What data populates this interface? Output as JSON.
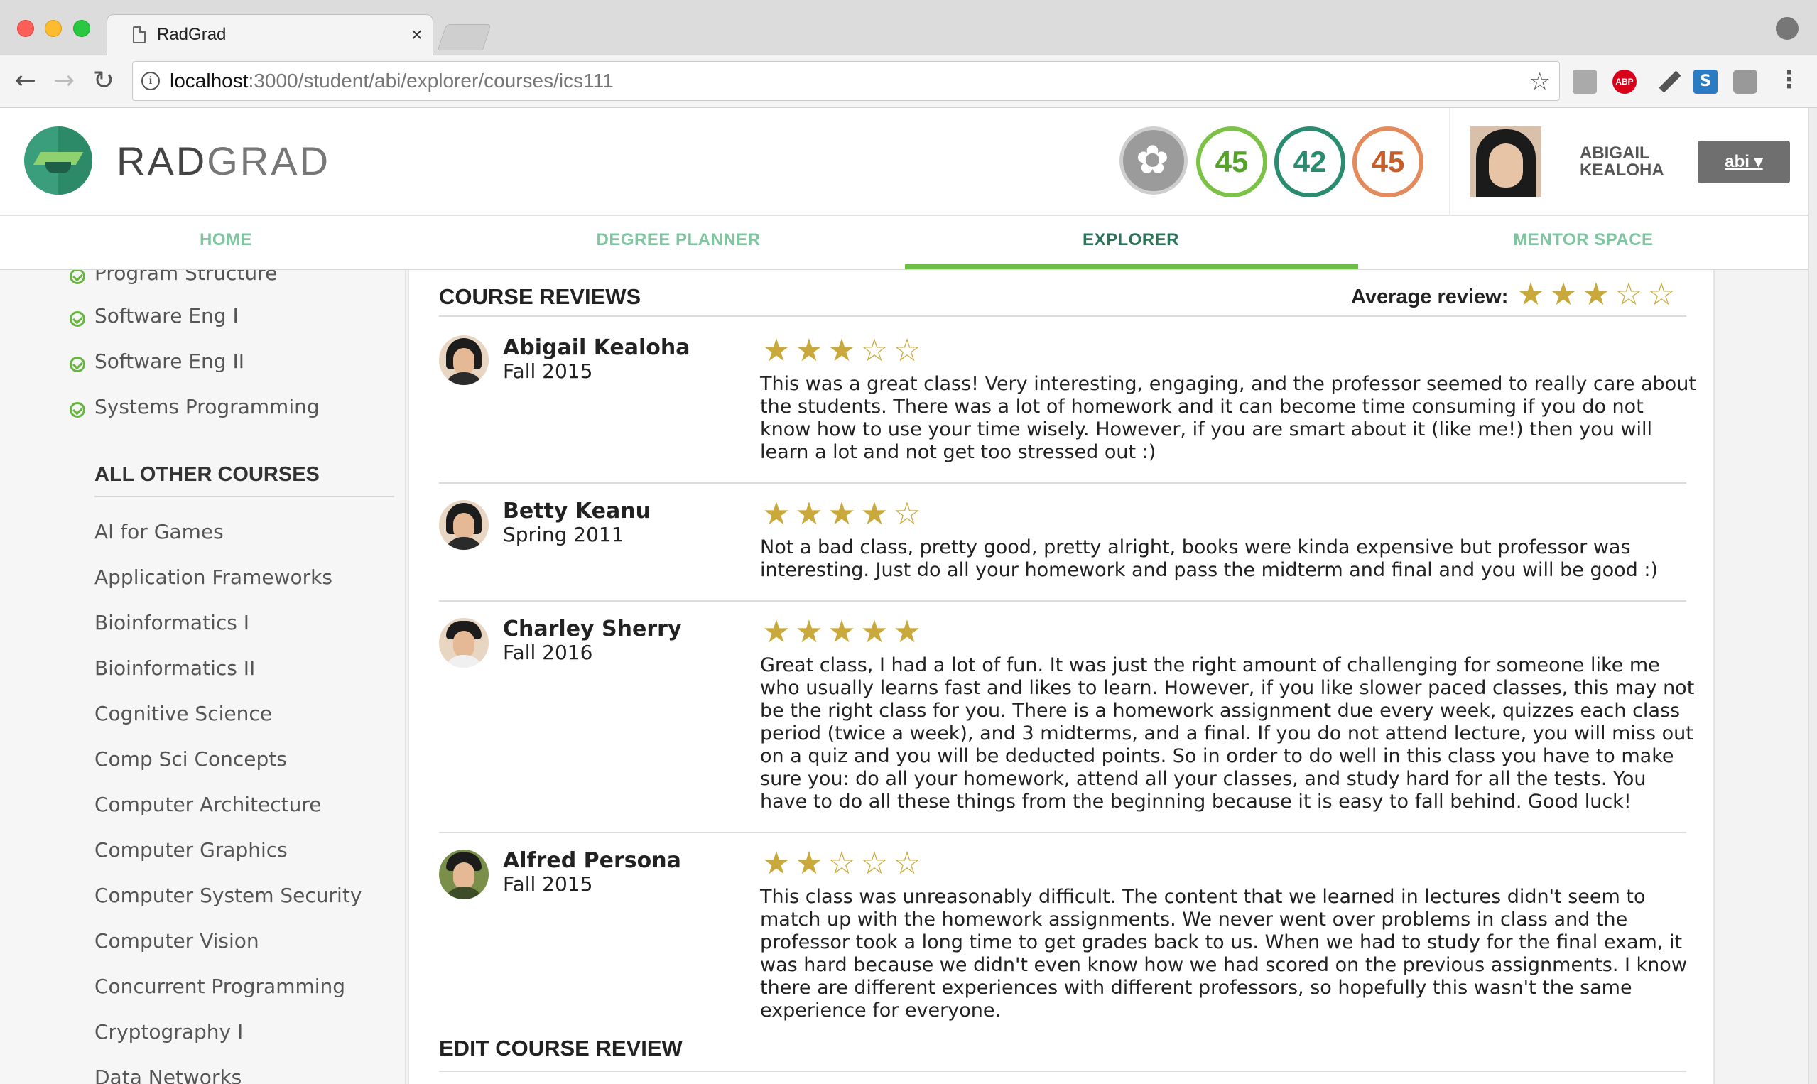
{
  "browser": {
    "tab_title": "RadGrad",
    "tab_close": "×",
    "url_host": "localhost",
    "url_path": ":3000/student/abi/explorer/courses/ics111",
    "abp_label": "ABP",
    "s_label": "S",
    "kebab": "⋮"
  },
  "header": {
    "brand_rad": "RAD",
    "brand_grad": "GRAD",
    "stats": {
      "innovation": "45",
      "competency": "42",
      "experience": "45"
    },
    "user_name_line1": "ABIGAIL",
    "user_name_line2": "KEALOHA",
    "user_menu_label": "abi ▾",
    "colors": {
      "logo": "#3a9d7c",
      "innovation": "#7cc247",
      "competency": "#2a8c6f",
      "experience": "#e38b5c"
    }
  },
  "nav": {
    "items": [
      {
        "label": "HOME"
      },
      {
        "label": "DEGREE PLANNER"
      },
      {
        "label": "EXPLORER",
        "active": true
      },
      {
        "label": "MENTOR SPACE"
      }
    ]
  },
  "sidebar": {
    "completed": [
      {
        "label": "Program Structure"
      },
      {
        "label": "Software Eng I"
      },
      {
        "label": "Software Eng II"
      },
      {
        "label": "Systems Programming"
      }
    ],
    "other_heading": "ALL OTHER COURSES",
    "other_courses": [
      {
        "label": "AI for Games"
      },
      {
        "label": "Application Frameworks"
      },
      {
        "label": "Bioinformatics I"
      },
      {
        "label": "Bioinformatics II"
      },
      {
        "label": "Cognitive Science"
      },
      {
        "label": "Comp Sci Concepts"
      },
      {
        "label": "Computer Architecture"
      },
      {
        "label": "Computer Graphics"
      },
      {
        "label": "Computer System Security"
      },
      {
        "label": "Computer Vision"
      },
      {
        "label": "Concurrent Programming"
      },
      {
        "label": "Cryptography I"
      },
      {
        "label": "Data Networks"
      }
    ]
  },
  "reviews_panel": {
    "title": "COURSE REVIEWS",
    "average_label": "Average review:",
    "average_rating": 3,
    "max_rating": 5,
    "star_color": "#c9a93b",
    "reviews": [
      {
        "name": "Abigail Kealoha",
        "term": "Fall 2015",
        "rating": 3,
        "text": "This was a great class! Very interesting, engaging, and the professor seemed to really care about the students. There was a lot of homework and it can become time consuming if you do not know how to use your time wisely. However, if you are smart about it (like me!) then you will learn a lot and not get too stressed out :)"
      },
      {
        "name": "Betty Keanu",
        "term": "Spring 2011",
        "rating": 4,
        "text": "Not a bad class, pretty good, pretty alright, books were kinda expensive but professor was interesting. Just do all your homework and pass the midterm and final and you will be good :)"
      },
      {
        "name": "Charley Sherry",
        "term": "Fall 2016",
        "rating": 5,
        "text": "Great class, I had a lot of fun. It was just the right amount of challenging for someone like me who usually learns fast and likes to learn. However, if you like slower paced classes, this may not be the right class for you. There is a homework assignment due every week, quizzes each class period (twice a week), and 3 midterms, and a final. If you do not attend lecture, you will miss out on a quiz and you will be deducted points. So in order to do well in this class you have to make sure you: do all your homework, attend all your classes, and study hard for all the tests. You have to do all these things from the beginning because it is easy to fall behind. Good luck!"
      },
      {
        "name": "Alfred Persona",
        "term": "Fall 2015",
        "rating": 2,
        "text": "This class was unreasonably difficult. The content that we learned in lectures didn't seem to match up with the homework assignments. We never went over problems in class and the professor took a long time to get grades back to us. When we had to study for the final exam, it was hard because we didn't even know how we had scored on the previous assignments. I know there are different experiences with different professors, so hopefully this wasn't the same experience for everyone."
      }
    ],
    "edit_title": "EDIT COURSE REVIEW"
  }
}
